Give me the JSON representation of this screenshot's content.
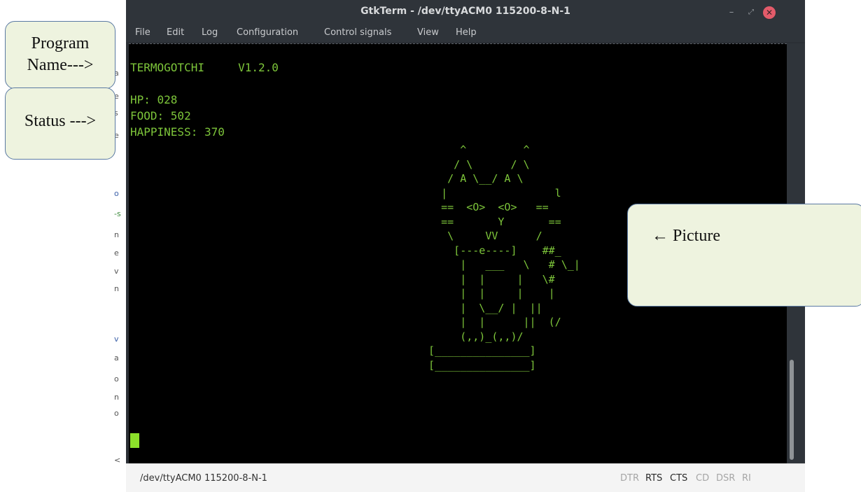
{
  "window": {
    "title": "GtkTerm - /dev/ttyACM0  115200-8-N-1",
    "controls": {
      "minimize": "–",
      "maximize": "⤢",
      "close": "✕"
    }
  },
  "menu": {
    "items": [
      "File",
      "Edit",
      "Log",
      "Configuration",
      "Control signals",
      "View",
      "Help"
    ]
  },
  "terminal": {
    "program_line": "TERMOGOTCHI     V1.2.0",
    "status": [
      "HP: 028",
      "FOOD: 502",
      "HAPPINESS: 370"
    ],
    "art": "       ^         ^\n      / \\      / \\\n     / A \\__/ A \\\n    |                 l\n    ==  <O>  <O>   ==\n    ==       Y       ==\n     \\     VV      /\n      [---e----]    ##_\n       |   ___   \\   # \\_|\n       |  |     |   \\#\n       |  |     |    |\n       |  \\__/ |  ||\n       |  |      ||  (/\n       (,,)_(,,)/\n  [_______________]\n  [_______________]"
  },
  "statusbar": {
    "port": "/dev/ttyACM0  115200-8-N-1",
    "signals": [
      {
        "label": "DTR",
        "active": false
      },
      {
        "label": "RTS",
        "active": true
      },
      {
        "label": "CTS",
        "active": true
      },
      {
        "label": "CD",
        "active": false
      },
      {
        "label": "DSR",
        "active": false
      },
      {
        "label": "RI",
        "active": false
      }
    ]
  },
  "annotations": {
    "program_name": "Program Name--->",
    "program_name_lines": [
      "Program",
      "Name--->"
    ],
    "status": "Status --->",
    "picture": "← Picture"
  },
  "background_fragments": [
    "a",
    "e",
    "s",
    "e",
    "o",
    "-s",
    "n",
    "e",
    "v",
    "n",
    "v",
    "a",
    "o",
    "n",
    "o",
    "<"
  ],
  "colors": {
    "terminal_text": "#7dc53a",
    "terminal_bg": "#000000",
    "titlebar": "#2f343a",
    "callout_fill": "#eef3df",
    "callout_border": "#5b7aa3",
    "close_button": "#e35b6a"
  }
}
